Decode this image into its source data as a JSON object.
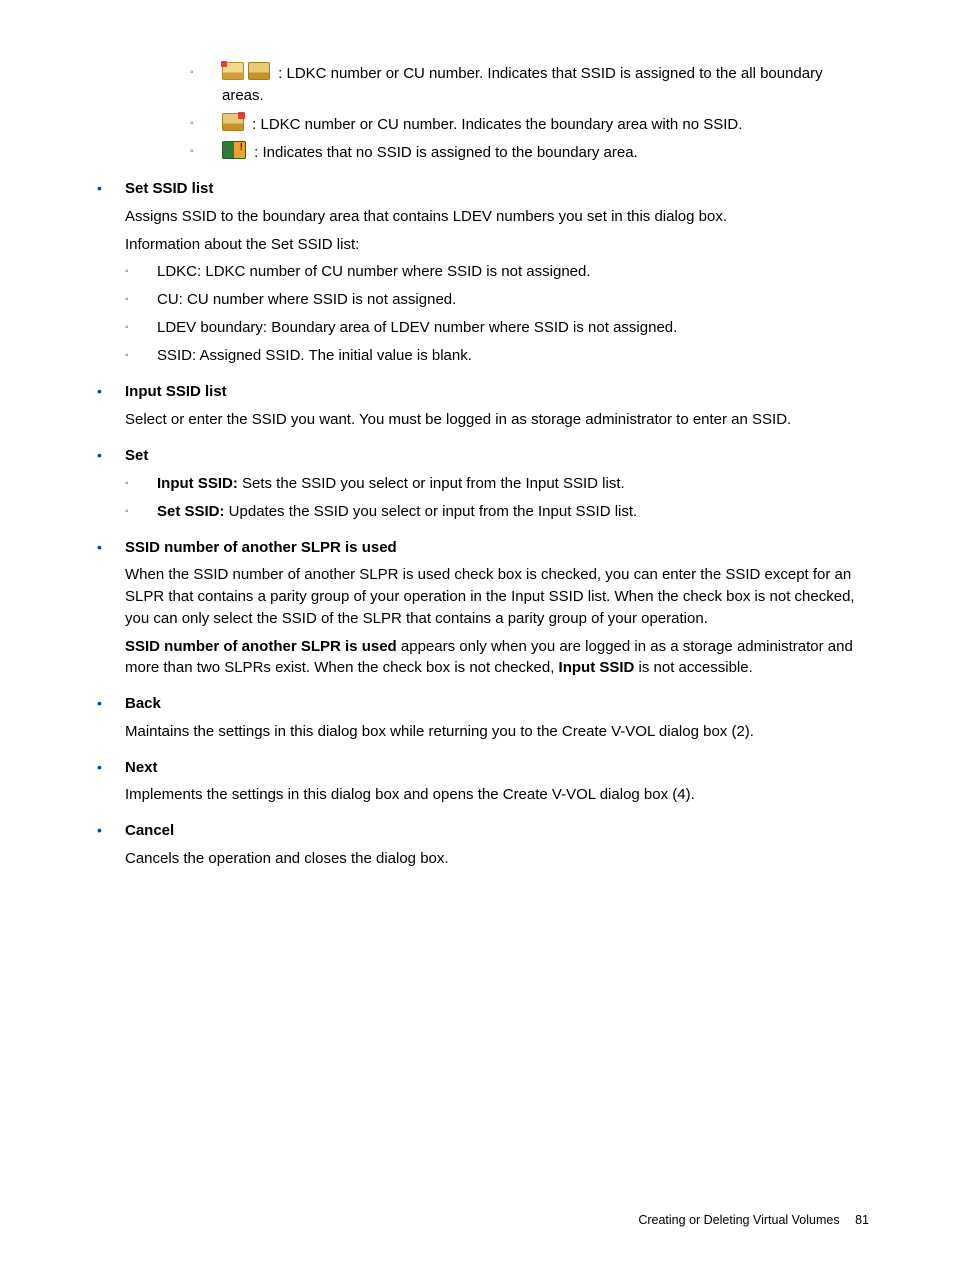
{
  "intro_sub": [
    {
      "icons": [
        "book-open",
        "book-closed"
      ],
      "text": " : LDKC number or CU number. Indicates that SSID is assigned to the all boundary areas."
    },
    {
      "icons": [
        "book-red"
      ],
      "text": " : LDKC number or CU number. Indicates the boundary area with no SSID."
    },
    {
      "icons": [
        "warn"
      ],
      "text": " : Indicates that no SSID is assigned to the boundary area."
    }
  ],
  "items": [
    {
      "heading": "Set SSID list",
      "paras": [
        "Assigns SSID to the boundary area that contains LDEV numbers you set in this dialog box.",
        "Information about the Set SSID list:"
      ],
      "sub": [
        {
          "text": "LDKC: LDKC number of CU number where SSID is not assigned."
        },
        {
          "text": "CU: CU number where SSID is not assigned."
        },
        {
          "text": "LDEV boundary: Boundary area of LDEV number where SSID is not assigned."
        },
        {
          "text": "SSID: Assigned SSID. The initial value is blank."
        }
      ]
    },
    {
      "heading": "Input SSID list",
      "paras": [
        "Select or enter the SSID you want. You must be logged in as storage administrator to enter an SSID."
      ]
    },
    {
      "heading": "Set",
      "sub": [
        {
          "bold": "Input SSID:",
          "text": " Sets the SSID you select or input from the Input SSID list."
        },
        {
          "bold": "Set SSID:",
          "text": " Updates the SSID you select or input from the Input SSID list."
        }
      ]
    },
    {
      "heading": "SSID number of another SLPR is used",
      "paras": [
        "When the SSID number of another SLPR is used check box is checked, you can enter the SSID except for an SLPR that contains a parity group of your operation in the Input SSID list. When the check box is not checked, you can only select the SSID of the SLPR that contains a parity group of your operation."
      ],
      "rich_paras": [
        {
          "bold1": "SSID number of another SLPR is used",
          "mid": " appears only when you are logged in as a storage administrator and more than two SLPRs exist. When the check box is not checked, ",
          "bold2": "Input SSID",
          "tail": " is not accessible."
        }
      ]
    },
    {
      "heading": "Back",
      "paras": [
        "Maintains the settings in this dialog box while returning you to the Create V-VOL dialog box (2)."
      ]
    },
    {
      "heading": "Next",
      "paras": [
        "Implements the settings in this dialog box and opens the Create V-VOL dialog box (4)."
      ]
    },
    {
      "heading": "Cancel",
      "paras": [
        "Cancels the operation and closes the dialog box."
      ]
    }
  ],
  "footer": {
    "title": "Creating or Deleting Virtual Volumes",
    "page": "81"
  }
}
